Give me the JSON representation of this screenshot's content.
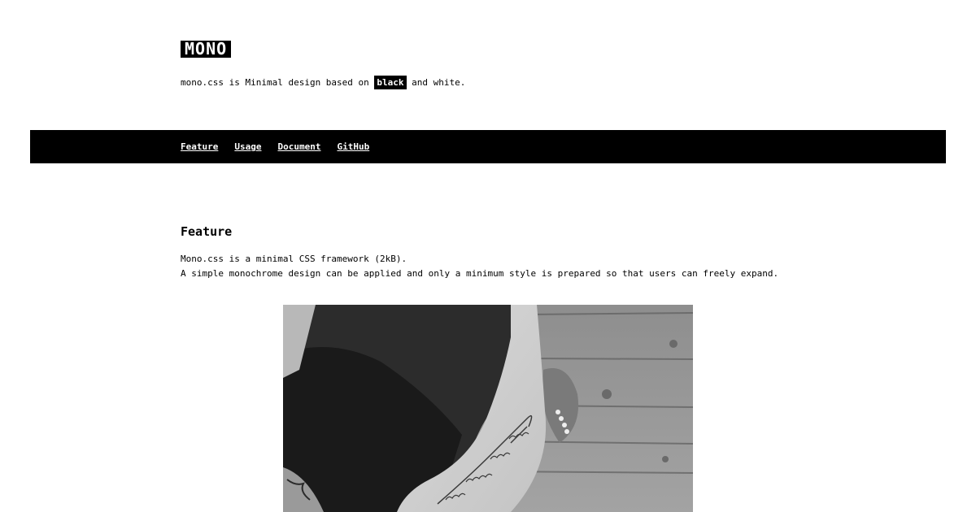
{
  "header": {
    "logo": "MONO",
    "tagline_before": "mono.css is Minimal design based on ",
    "tagline_highlight": "black",
    "tagline_after": " and white."
  },
  "nav": {
    "items": [
      {
        "label": "Feature"
      },
      {
        "label": "Usage"
      },
      {
        "label": "Document"
      },
      {
        "label": "GitHub"
      }
    ]
  },
  "feature": {
    "title": "Feature",
    "line1": "Mono.css is a minimal CSS framework (2kB).",
    "line2": "A simple monochrome design can be applied and only a minimum style is prepared so that users can freely expand."
  },
  "colors": {
    "background": "#ffffff",
    "foreground": "#000000"
  }
}
